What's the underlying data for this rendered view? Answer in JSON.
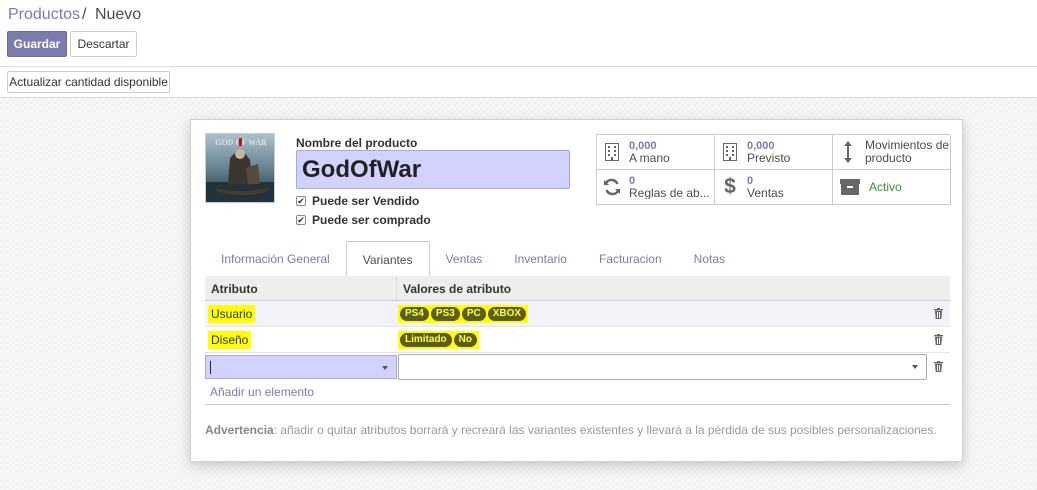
{
  "breadcrumb": {
    "parent": "Productos",
    "separator": "/",
    "current": "Nuevo"
  },
  "toolbar": {
    "save_label": "Guardar",
    "discard_label": "Descartar"
  },
  "statusbar": {
    "update_qty_label": "Actualizar cantidad disponible"
  },
  "product": {
    "name_label": "Nombre del producto",
    "name_value": "GodOfWar",
    "can_be_sold_label": "Puede ser Vendido",
    "can_be_sold": true,
    "can_be_purchased_label": "Puede ser comprado",
    "can_be_purchased": true,
    "image_text": "GOD OF WAR"
  },
  "smart_buttons": [
    {
      "icon": "building-icon",
      "value": "0,000",
      "label": "A mano"
    },
    {
      "icon": "building-icon",
      "value": "0,000",
      "label": "Previsto"
    },
    {
      "icon": "arrows-vertical-icon",
      "value": "",
      "label": "Movimientos de producto"
    },
    {
      "icon": "refresh-icon",
      "value": "0",
      "label": "Reglas de ab..."
    },
    {
      "icon": "dollar-icon",
      "value": "0",
      "label": "Ventas"
    },
    {
      "icon": "archive-icon",
      "value": "",
      "label": "Activo"
    }
  ],
  "tabs": [
    {
      "label": "Información General",
      "active": false
    },
    {
      "label": "Variantes",
      "active": true
    },
    {
      "label": "Ventas",
      "active": false
    },
    {
      "label": "Inventario",
      "active": false
    },
    {
      "label": "Facturacion",
      "active": false
    },
    {
      "label": "Notas",
      "active": false
    }
  ],
  "attributes_table": {
    "headers": {
      "attribute": "Atributo",
      "values": "Valores de atributo"
    },
    "rows": [
      {
        "attribute": "Usuario",
        "values": [
          "PS4",
          "PS3",
          "PC",
          "XBOX"
        ]
      },
      {
        "attribute": "Diseño",
        "values": [
          "Limitado",
          "No"
        ]
      }
    ],
    "add_line_label": "Añadir un elemento"
  },
  "warning": {
    "prefix": "Advertencia",
    "text": ": añadir o quitar atributos borrará y recreará las variantes existentes y llevará a la pérdida de sus posibles personalizaciones."
  },
  "colors": {
    "brand": "#7c7bad",
    "input_required": "#d2d2ff",
    "highlight": "#ffff00",
    "active_green": "#3c8d3c"
  }
}
